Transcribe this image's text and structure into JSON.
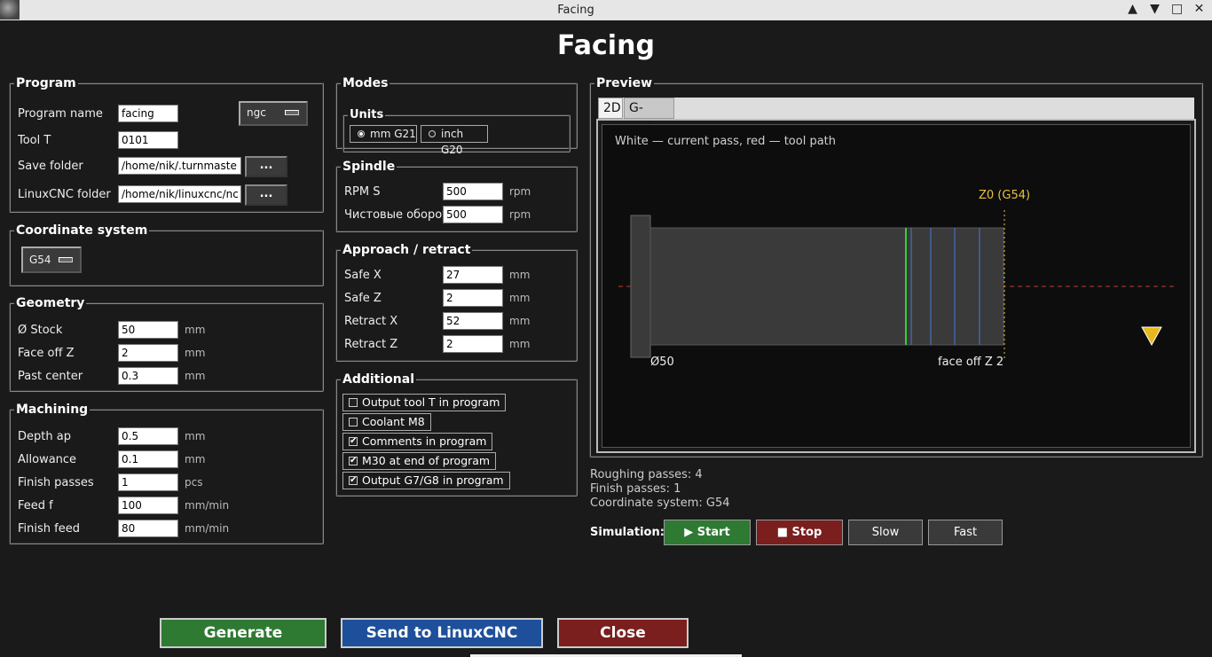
{
  "window": {
    "title": "Facing",
    "app_icon": "turnmaster-icon",
    "btn_minimize": "▲",
    "btn_restore": "▼",
    "btn_maximize": "□",
    "btn_close": "✕"
  },
  "heading": "Facing",
  "program": {
    "legend": "Program",
    "name_label": "Program name",
    "name_value": "facing",
    "ext_value": "ngc",
    "tool_label": "Tool T",
    "tool_value": "0101",
    "save_label": "Save folder",
    "save_value": "/home/nik/.turnmaster/gen",
    "linuxcnc_label": "LinuxCNC folder",
    "linuxcnc_value": "/home/nik/linuxcnc/nc_files",
    "browse_label": "..."
  },
  "coord": {
    "legend": "Coordinate system",
    "value": "G54"
  },
  "geometry": {
    "legend": "Geometry",
    "rows": [
      {
        "label": "Ø Stock",
        "value": "50",
        "unit": "mm"
      },
      {
        "label": "Face off Z",
        "value": "2",
        "unit": "mm"
      },
      {
        "label": "Past center",
        "value": "0.3",
        "unit": "mm"
      }
    ]
  },
  "machining": {
    "legend": "Machining",
    "rows": [
      {
        "label": "Depth ap",
        "value": "0.5",
        "unit": "mm"
      },
      {
        "label": "Allowance",
        "value": "0.1",
        "unit": "mm"
      },
      {
        "label": "Finish passes",
        "value": "1",
        "unit": "pcs"
      },
      {
        "label": "Feed f",
        "value": "100",
        "unit": "mm/min"
      },
      {
        "label": "Finish feed",
        "value": "80",
        "unit": "mm/min"
      }
    ]
  },
  "modes": {
    "legend": "Modes",
    "units_legend": "Units",
    "mm_label": "mm G21",
    "inch_label": "inch G20"
  },
  "spindle": {
    "legend": "Spindle",
    "rows": [
      {
        "label": "RPM S",
        "value": "500",
        "unit": "rpm"
      },
      {
        "label": "Чистовые оборот",
        "value": "500",
        "unit": "rpm"
      }
    ]
  },
  "approach": {
    "legend": "Approach / retract",
    "rows": [
      {
        "label": "Safe X",
        "value": "27",
        "unit": "mm"
      },
      {
        "label": "Safe Z",
        "value": "2",
        "unit": "mm"
      },
      {
        "label": "Retract X",
        "value": "52",
        "unit": "mm"
      },
      {
        "label": "Retract Z",
        "value": "2",
        "unit": "mm"
      }
    ]
  },
  "additional": {
    "legend": "Additional",
    "items": [
      {
        "label": "Output tool T in program",
        "checked": false
      },
      {
        "label": "Coolant M8",
        "checked": false
      },
      {
        "label": "Comments in program",
        "checked": true
      },
      {
        "label": "M30 at end of program",
        "checked": true
      },
      {
        "label": "Output G7/G8 in program",
        "checked": true
      }
    ]
  },
  "preview": {
    "legend": "Preview",
    "tab_2d": "2D",
    "tab_gcode": "G-code",
    "hint": "White — current pass, red — tool path",
    "z0_label": "Z0 (G54)",
    "dia_label": "Ø50",
    "faceoff_label": "face off Z 2",
    "colors": {
      "stock": "#3a3a3a",
      "axis": "#c0392b",
      "pass": "#35d035",
      "passes": "#4a78d8",
      "z0": "#e8c040",
      "tool": "#e8b820"
    }
  },
  "stats": {
    "roughing": "Roughing passes: 4",
    "finish": "Finish passes: 1",
    "coord": "Coordinate system: G54"
  },
  "simulation": {
    "label": "Simulation:",
    "start": "▶ Start",
    "stop": "■ Stop",
    "slow": "Slow",
    "fast": "Fast"
  },
  "actions": {
    "generate": "Generate",
    "send": "Send to LinuxCNC",
    "close": "Close"
  }
}
